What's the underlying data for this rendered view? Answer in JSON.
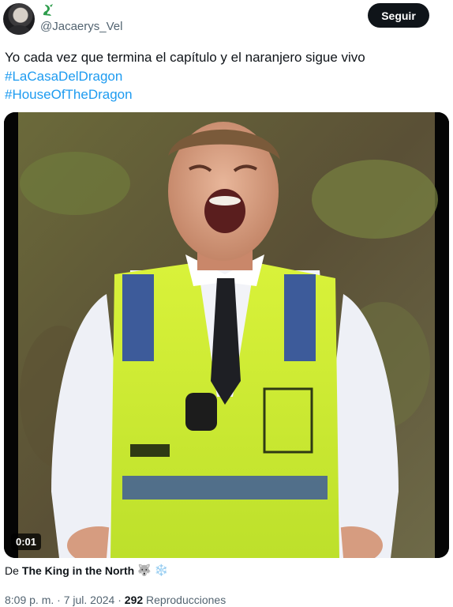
{
  "author": {
    "handle": "@Jacaerys_Vel",
    "avatar_icon": "profile-avatar",
    "badge_icon": "dragon-icon"
  },
  "follow_label": "Seguir",
  "tweet": {
    "text": "Yo cada vez que termina el capítulo y el naranjero sigue vivo",
    "hashtags": [
      "#LaCasaDelDragon",
      "#HouseOfTheDragon"
    ]
  },
  "media": {
    "type": "video",
    "timestamp": "0:01"
  },
  "source": {
    "prefix": "De",
    "account": "The King in the North",
    "emojis": "🐺 ❄️"
  },
  "meta": {
    "time": "8:09 p. m.",
    "separator": "·",
    "date": "7 jul. 2024",
    "views_count": "292",
    "views_label": "Reproducciones"
  },
  "colors": {
    "accent": "#1d9bf0",
    "text": "#0f1419",
    "muted": "#536471",
    "button": "#0f1419"
  }
}
